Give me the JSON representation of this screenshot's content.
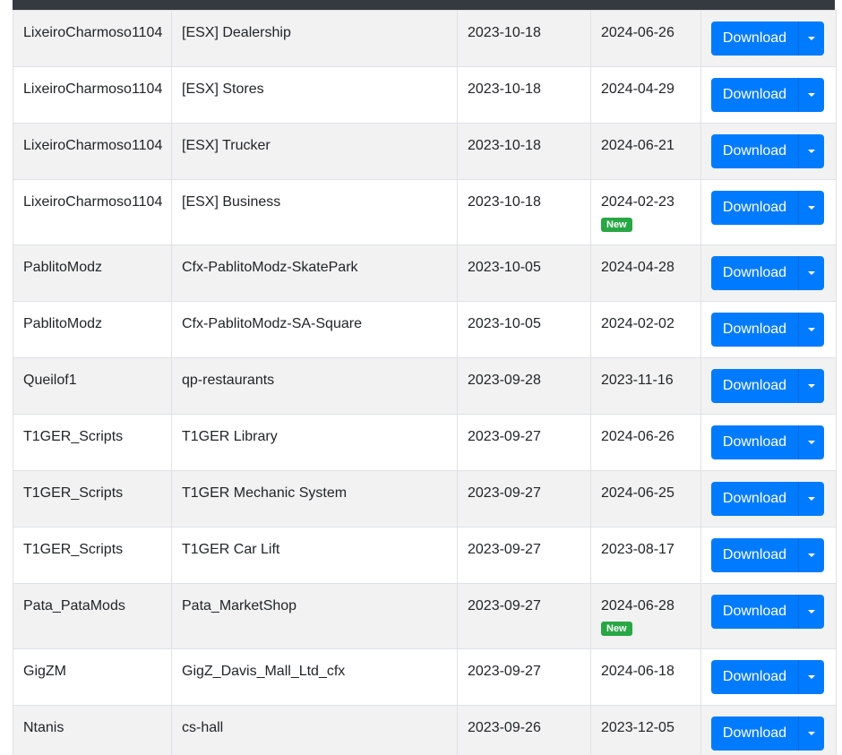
{
  "table": {
    "download_label": "Download",
    "new_badge_label": "New",
    "rows": [
      {
        "author": "LixeiroCharmoso1104",
        "name": "[ESX] Dealership",
        "created": "2023-10-18",
        "updated": "2024-06-26",
        "is_new": false
      },
      {
        "author": "LixeiroCharmoso1104",
        "name": "[ESX] Stores",
        "created": "2023-10-18",
        "updated": "2024-04-29",
        "is_new": false
      },
      {
        "author": "LixeiroCharmoso1104",
        "name": "[ESX] Trucker",
        "created": "2023-10-18",
        "updated": "2024-06-21",
        "is_new": false
      },
      {
        "author": "LixeiroCharmoso1104",
        "name": "[ESX] Business",
        "created": "2023-10-18",
        "updated": "2024-02-23",
        "is_new": true
      },
      {
        "author": "PablitoModz",
        "name": "Cfx-PablitoModz-SkatePark",
        "created": "2023-10-05",
        "updated": "2024-04-28",
        "is_new": false
      },
      {
        "author": "PablitoModz",
        "name": "Cfx-PablitoModz-SA-Square",
        "created": "2023-10-05",
        "updated": "2024-02-02",
        "is_new": false
      },
      {
        "author": "Queilof1",
        "name": "qp-restaurants",
        "created": "2023-09-28",
        "updated": "2023-11-16",
        "is_new": false
      },
      {
        "author": "T1GER_Scripts",
        "name": "T1GER Library",
        "created": "2023-09-27",
        "updated": "2024-06-26",
        "is_new": false
      },
      {
        "author": "T1GER_Scripts",
        "name": "T1GER Mechanic System",
        "created": "2023-09-27",
        "updated": "2024-06-25",
        "is_new": false
      },
      {
        "author": "T1GER_Scripts",
        "name": "T1GER Car Lift",
        "created": "2023-09-27",
        "updated": "2023-08-17",
        "is_new": false
      },
      {
        "author": "Pata_PataMods",
        "name": "Pata_MarketShop",
        "created": "2023-09-27",
        "updated": "2024-06-28",
        "is_new": true
      },
      {
        "author": "GigZM",
        "name": "GigZ_Davis_Mall_Ltd_cfx",
        "created": "2023-09-27",
        "updated": "2024-06-18",
        "is_new": false
      },
      {
        "author": "Ntanis",
        "name": "cs-hall",
        "created": "2023-09-26",
        "updated": "2023-12-05",
        "is_new": false
      }
    ]
  },
  "colors": {
    "header": "#343a40",
    "primary": "#007bff",
    "badge_success": "#28a745",
    "row_stripe": "#f2f2f2",
    "border": "#dee2e6"
  },
  "icons": {
    "dropdown": "caret-down-icon"
  }
}
